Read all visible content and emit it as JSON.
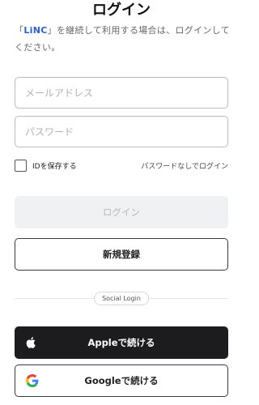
{
  "header": {
    "title": "ログイン"
  },
  "intro": {
    "prefix": "「",
    "brand": "LiNC",
    "suffix": "」を継続して利用する場合は、ログインしてください。"
  },
  "form": {
    "email_placeholder": "メールアドレス",
    "password_placeholder": "パスワード",
    "save_id_label": "IDを保存する",
    "forgot_link": "パスワードなしでログイン"
  },
  "actions": {
    "login_label": "ログイン",
    "register_label": "新規登録"
  },
  "social": {
    "divider_label": "Social Login",
    "apple_label": "Appleで続ける",
    "apple_icon": "apple-icon",
    "google_label": "Googleで続ける",
    "google_icon": "google-icon"
  },
  "colors": {
    "brand": "#2a62d6",
    "apple_bg": "#1c1c1e",
    "login_disabled_bg": "#f0f1f3"
  }
}
